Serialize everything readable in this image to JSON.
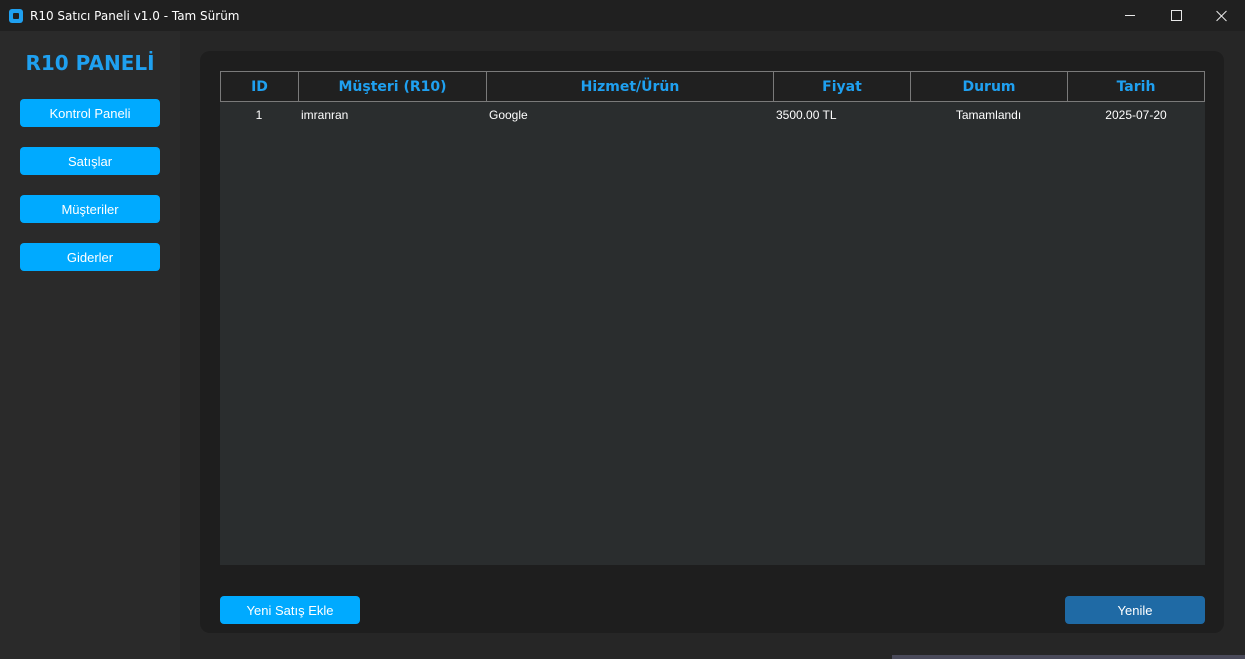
{
  "window": {
    "title": "R10 Satıcı Paneli v1.0 - Tam Sürüm",
    "controls": {
      "minimize": "minimize",
      "maximize": "maximize",
      "close": "close"
    }
  },
  "sidebar": {
    "brand": "R10 PANELİ",
    "items": [
      {
        "label": "Kontrol Paneli"
      },
      {
        "label": "Satışlar"
      },
      {
        "label": "Müşteriler"
      },
      {
        "label": "Giderler"
      }
    ]
  },
  "table": {
    "columns": [
      "ID",
      "Müşteri (R10)",
      "Hizmet/Ürün",
      "Fiyat",
      "Durum",
      "Tarih"
    ],
    "rows": [
      {
        "id": "1",
        "customer": "imranran",
        "service": "Google",
        "price": "3500.00 TL",
        "status": "Tamamlandı",
        "date": "2025-07-20"
      }
    ]
  },
  "actions": {
    "new_sale": "Yeni Satış Ekle",
    "refresh": "Yenile"
  },
  "colors": {
    "accent": "#1fa0f0",
    "button": "#00aaff",
    "refresh_button": "#1f6aa5",
    "panel_bg": "#1e1e1e",
    "table_bg": "#2a2d2e"
  }
}
